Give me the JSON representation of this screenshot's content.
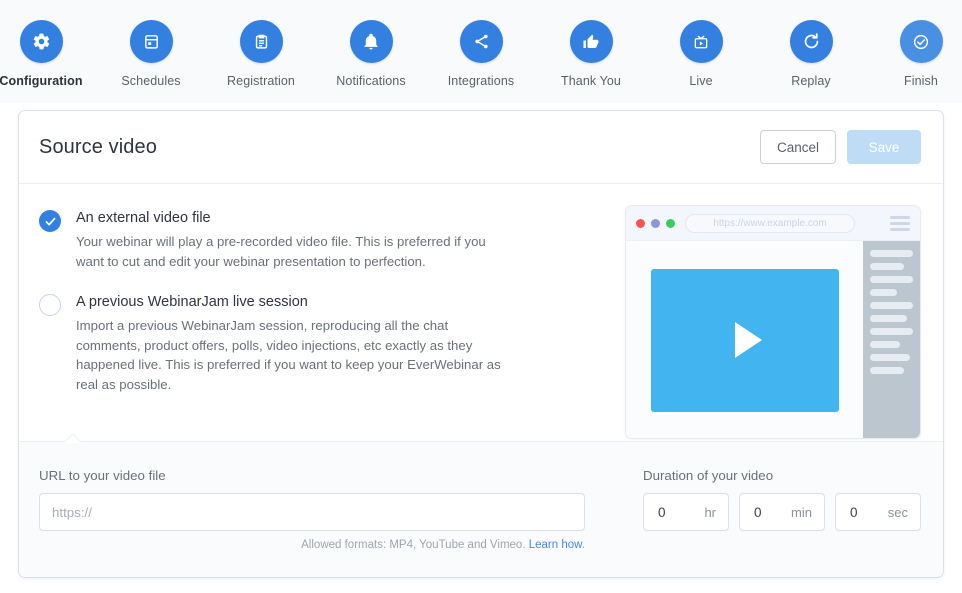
{
  "stepnav": {
    "steps": [
      {
        "label": "Configuration",
        "icon": "gear-icon",
        "active": true
      },
      {
        "label": "Schedules",
        "icon": "calendar-icon",
        "active": false
      },
      {
        "label": "Registration",
        "icon": "clipboard-icon",
        "active": false
      },
      {
        "label": "Notifications",
        "icon": "bell-icon",
        "active": false
      },
      {
        "label": "Integrations",
        "icon": "share-icon",
        "active": false
      },
      {
        "label": "Thank You",
        "icon": "thumbs-up-icon",
        "active": false
      },
      {
        "label": "Live",
        "icon": "tv-play-icon",
        "active": false
      },
      {
        "label": "Replay",
        "icon": "refresh-icon",
        "active": false
      },
      {
        "label": "Finish",
        "icon": "check-shield-icon",
        "active": false
      }
    ]
  },
  "card": {
    "title": "Source video",
    "cancel_label": "Cancel",
    "save_label": "Save"
  },
  "options": [
    {
      "title": "An external video file",
      "desc": "Your webinar will play a pre-recorded video file. This is preferred if you want to cut and edit your webinar presentation to perfection.",
      "selected": true
    },
    {
      "title": "A previous WebinarJam live session",
      "desc": "Import a previous WebinarJam session, reproducing all the chat comments, product offers, polls, video injections, etc exactly as they happened live. This is preferred if you want to keep your EverWebinar as real as possible.",
      "selected": false
    }
  ],
  "preview": {
    "url_text": "https://www.example.com",
    "dots": [
      "red",
      "purple",
      "green"
    ]
  },
  "form": {
    "url_label": "URL to your video file",
    "url_value": "",
    "url_placeholder": "https://",
    "hint_text": "Allowed formats: MP4, YouTube and Vimeo. ",
    "hint_link": "Learn how",
    "hint_tail": ".",
    "duration_label": "Duration of your video",
    "duration": [
      {
        "value": "0",
        "unit": "hr"
      },
      {
        "value": "0",
        "unit": "min"
      },
      {
        "value": "0",
        "unit": "sec"
      }
    ]
  },
  "colors": {
    "accent": "#3380e0",
    "video_blue": "#42b4f0",
    "save_disabled": "#bedcf6",
    "link": "#3d8bf2"
  }
}
